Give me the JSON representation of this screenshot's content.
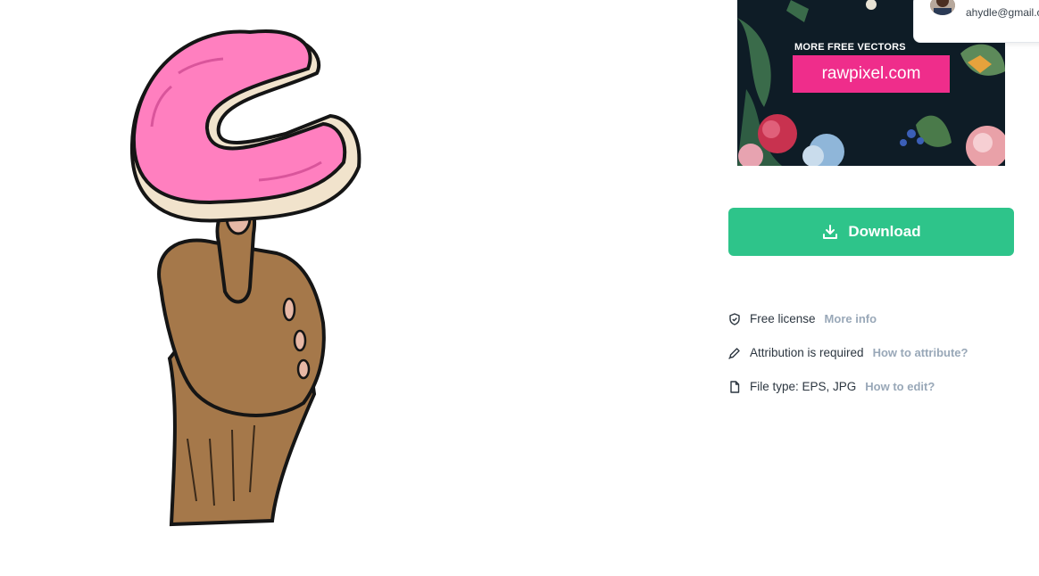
{
  "ad": {
    "tagline": "MORE FREE VECTORS",
    "button_label": "rawpixel.com",
    "colors": {
      "background": "#0e1c26",
      "button": "#ef2d8b"
    }
  },
  "account": {
    "email": "ahydle@gmail.c"
  },
  "download": {
    "label": "Download",
    "icon": "download-icon",
    "color": "#2ec48a"
  },
  "details": {
    "license": {
      "icon": "shield-check-icon",
      "text": "Free license",
      "link": "More info"
    },
    "attribution": {
      "icon": "pen-icon",
      "text": "Attribution is required",
      "link": "How to attribute?"
    },
    "file_type": {
      "icon": "file-icon",
      "text": "File type: EPS, JPG",
      "link": "How to edit?"
    }
  },
  "colors": {
    "link": "#99a8b8",
    "text": "#2c3640"
  }
}
